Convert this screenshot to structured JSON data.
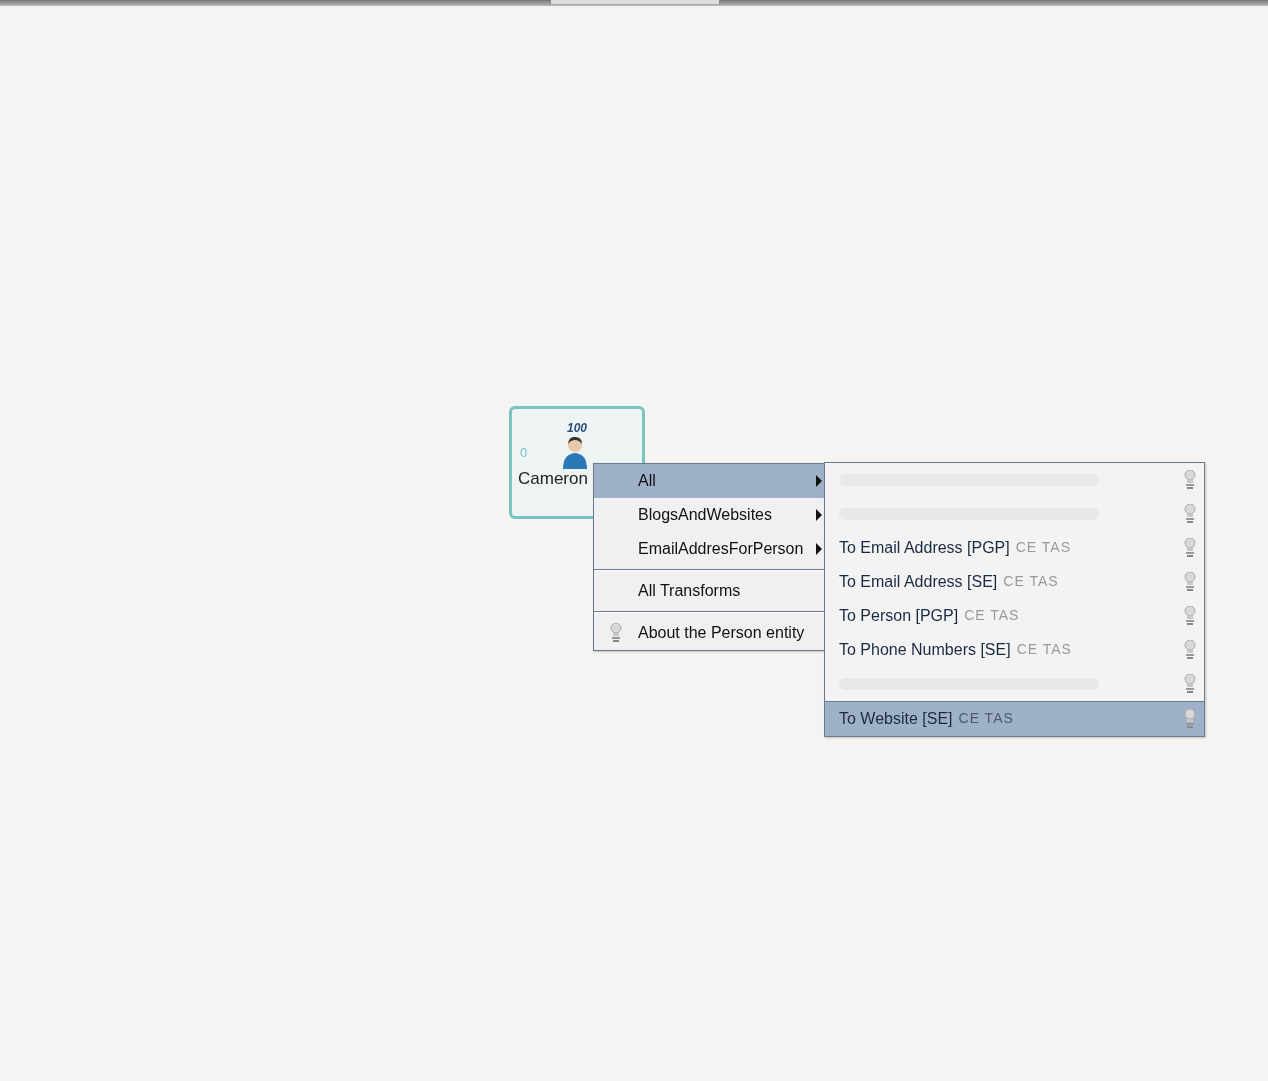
{
  "node": {
    "weight": "100",
    "incoming": "0",
    "label": "Cameron"
  },
  "context_menu": {
    "items": [
      {
        "kind": "submenu",
        "label": "All",
        "selected": true
      },
      {
        "kind": "submenu",
        "label": "BlogsAndWebsites",
        "selected": false
      },
      {
        "kind": "submenu",
        "label": "EmailAddresForPerson",
        "selected": false
      },
      {
        "kind": "separator"
      },
      {
        "kind": "action",
        "label": "All Transforms",
        "selected": false
      },
      {
        "kind": "separator"
      },
      {
        "kind": "info",
        "label": "About the Person entity",
        "selected": false
      }
    ]
  },
  "submenu": {
    "items": [
      {
        "kind": "illegible",
        "selected": false
      },
      {
        "kind": "illegible",
        "selected": false
      },
      {
        "kind": "transform",
        "label": "To Email Address [PGP]",
        "tag": "CE TAS",
        "selected": false
      },
      {
        "kind": "transform",
        "label": "To Email Address [SE]",
        "tag": "CE TAS",
        "selected": false
      },
      {
        "kind": "transform",
        "label": "To Person [PGP]",
        "tag": "CE TAS",
        "selected": false
      },
      {
        "kind": "transform",
        "label": "To Phone Numbers [SE]",
        "tag": "CE TAS",
        "selected": false
      },
      {
        "kind": "illegible",
        "selected": false
      },
      {
        "kind": "transform",
        "label": "To Website [SE]",
        "tag": "CE TAS",
        "selected": true
      }
    ]
  }
}
